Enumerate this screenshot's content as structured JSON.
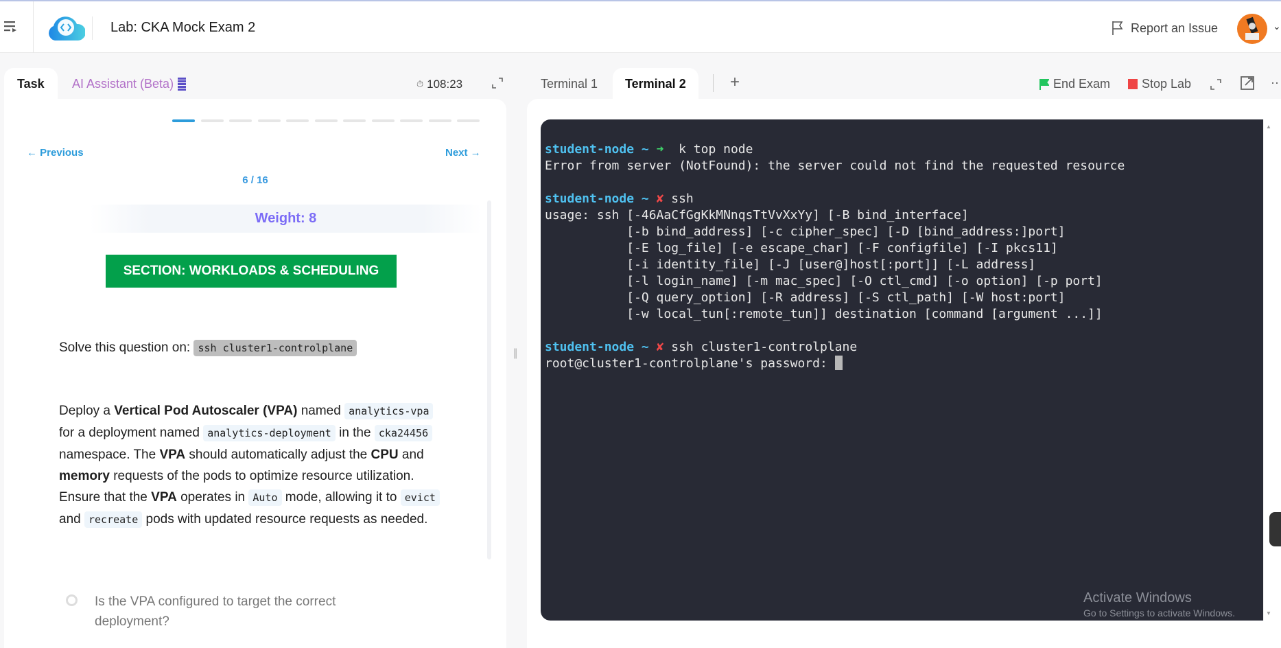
{
  "header": {
    "title": "Lab: CKA Mock Exam 2",
    "report_label": "Report an Issue"
  },
  "left_tabs": [
    {
      "label": "Task",
      "active": true
    },
    {
      "label": "AI Assistant (Beta)",
      "active": false
    }
  ],
  "timer": "108:23",
  "progress": {
    "total_dashes": 11,
    "active_index": 0
  },
  "nav": {
    "previous": "Previous",
    "next": "Next",
    "counter": "6 / 16"
  },
  "question": {
    "weight": "Weight: 8",
    "section": "SECTION: WORKLOADS & SCHEDULING",
    "solve_label": "Solve this question on:",
    "solve_code": "ssh cluster1-controlplane",
    "p": [
      "Deploy a ",
      "Vertical Pod Autoscaler (VPA)",
      " named ",
      "analytics-vpa",
      " for a deployment named ",
      "analytics-deployment",
      " in the ",
      "cka24456",
      " namespace. The ",
      "VPA",
      " should automatically adjust the ",
      "CPU",
      " and ",
      "memory",
      " requests of the pods to optimize resource utilization. Ensure that the ",
      "VPA",
      " operates in ",
      "Auto",
      " mode, allowing it to ",
      "evict",
      " and ",
      "recreate",
      " pods with updated resource requests as needed."
    ],
    "check_item": "Is the VPA configured to target the correct deployment?"
  },
  "right_tabs": [
    {
      "label": "Terminal 1",
      "active": false
    },
    {
      "label": "Terminal 2",
      "active": true
    }
  ],
  "toolbar": {
    "end_exam": "End Exam",
    "stop_lab": "Stop Lab"
  },
  "colors": {
    "end_exam": "#22c55e",
    "stop_lab": "#ef4444",
    "section": "#03a04b",
    "weight": "#7b6cf6",
    "link": "#2d9cdb"
  },
  "terminal": {
    "prompt": "student-node ~",
    "cmd1": "k top node",
    "out1": "Error from server (NotFound): the server could not find the requested resource",
    "cmd2": "ssh",
    "out2": [
      "usage: ssh [-46AaCfGgKkMNnqsTtVvXxYy] [-B bind_interface]",
      "           [-b bind_address] [-c cipher_spec] [-D [bind_address:]port]",
      "           [-E log_file] [-e escape_char] [-F configfile] [-I pkcs11]",
      "           [-i identity_file] [-J [user@]host[:port]] [-L address]",
      "           [-l login_name] [-m mac_spec] [-O ctl_cmd] [-o option] [-p port]",
      "           [-Q query_option] [-R address] [-S ctl_path] [-W host:port]",
      "           [-w local_tun[:remote_tun]] destination [command [argument ...]]"
    ],
    "cmd3": "ssh cluster1-controlplane",
    "out3": "root@cluster1-controlplane's password: "
  },
  "watermark": {
    "title": "Activate Windows",
    "subtitle": "Go to Settings to activate Windows."
  }
}
